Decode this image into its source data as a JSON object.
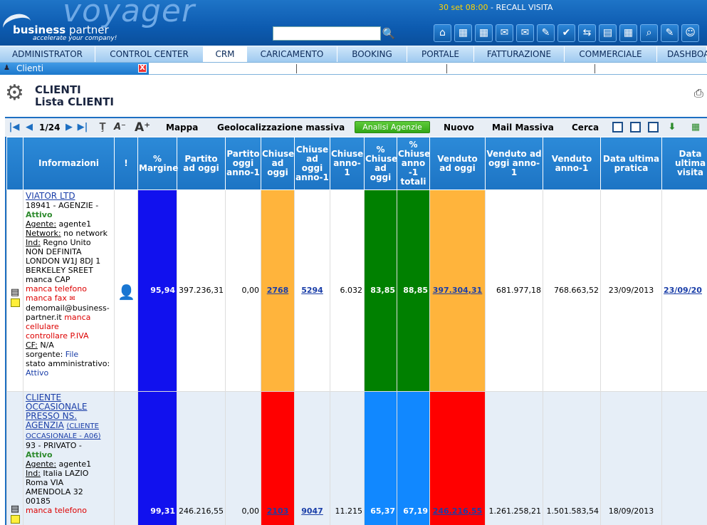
{
  "header": {
    "logo_main": "voyager",
    "logo_brand_a": "business",
    "logo_brand_b": " partner",
    "logo_tag": "accelerate your company!",
    "datetime": "30 set 08:00",
    "reminder": " - RECALL VISITA",
    "search_placeholder": "",
    "search_value": ""
  },
  "menu": [
    "ADMINISTRATOR",
    "CONTROL CENTER",
    "CRM",
    "CARICAMENTO",
    "BOOKING",
    "PORTALE",
    "FATTURAZIONE",
    "COMMERCIALE",
    "DASHBOA"
  ],
  "tab": {
    "label": "Clienti",
    "close": "X"
  },
  "title": {
    "main": "CLIENTI",
    "sub": "Lista CLIENTI"
  },
  "toolbar": {
    "page": "1/24",
    "mappa": "Mappa",
    "geo": "Geolocalizzazione massiva",
    "analisi": "Analisi Agenzie",
    "nuovo": "Nuovo",
    "mail": "Mail Massiva",
    "cerca": "Cerca"
  },
  "table": {
    "headers": [
      "Informazioni",
      "!",
      "% Margine",
      "Partito ad oggi",
      "Partito oggi anno-1",
      "Chiuse ad oggi",
      "Chiuse ad oggi anno-1",
      "Chiuse anno-1",
      "% Chiuse ad oggi",
      "% Chiuse anno -1 totali",
      "Venduto ad oggi",
      "Venduto ad oggi anno-1",
      "Venduto anno-1",
      "Data ultima pratica",
      "Data ultima visita"
    ],
    "rows": [
      {
        "name": "VIATOR LTD",
        "code": "18941 - AGENZIE -",
        "status": "Attivo",
        "agent_label": "Agente:",
        "agent": " agente1",
        "network_label": "Network:",
        "network": " no network",
        "ind_label": "Ind:",
        "address": [
          " Regno Unito",
          "NON DEFINITA",
          "LONDON W1J 8DJ 1",
          "BERKELEY SREET",
          "manca CAP"
        ],
        "warn1": "manca telefono",
        "warn2": "manca fax",
        "email": "demomail@business-partner.it",
        "warn3": "manca cellulare",
        "warn4": "controllare P.IVA",
        "cf_label": "CF:",
        "cf": " N/A",
        "source_label": "sorgente: ",
        "source": "File",
        "admin_label": "stato amministrativo:",
        "admin": "Attivo",
        "margine": "95,94",
        "partito": "397.236,31",
        "partito_prev": "0,00",
        "chiuse": "2768",
        "chiuse_prev": "5294",
        "chiuse_anno": "6.032",
        "pct_chiuse": "83,85",
        "pct_totali": "88,85",
        "venduto": "397.304,31",
        "venduto_prev": "681.977,18",
        "venduto_anno": "768.663,52",
        "data_pratica": "23/09/2013",
        "data_visita": "23/09/20"
      },
      {
        "name": "CLIENTE OCCASIONALE PRESSO NS. AGENZIA",
        "name_extra": "(CLIENTE OCCASIONALE - A06)",
        "code": "93 - PRIVATO -",
        "status": "Attivo",
        "agent_label": "Agente:",
        "agent": " agente1",
        "ind_label": "Ind:",
        "address": [
          " Italia LAZIO",
          "Roma VIA",
          "AMENDOLA 32",
          "00185"
        ],
        "warn1": "manca telefono",
        "margine": "99,31",
        "partito": "246.216,55",
        "partito_prev": "0,00",
        "chiuse": "2103",
        "chiuse_prev": "9047",
        "chiuse_anno": "11.215",
        "pct_chiuse": "65,37",
        "pct_totali": "67,19",
        "venduto": "246.216,55",
        "venduto_prev": "1.261.258,21",
        "venduto_anno": "1.501.583,54",
        "data_pratica": "18/09/2013",
        "data_visita": ""
      }
    ]
  },
  "colors": {
    "header_blue": "#1d74c4",
    "blue": "#1111ee",
    "orange": "#ffb43c",
    "green": "#008000",
    "red": "#ff0000",
    "light_blue": "#1188ff"
  }
}
